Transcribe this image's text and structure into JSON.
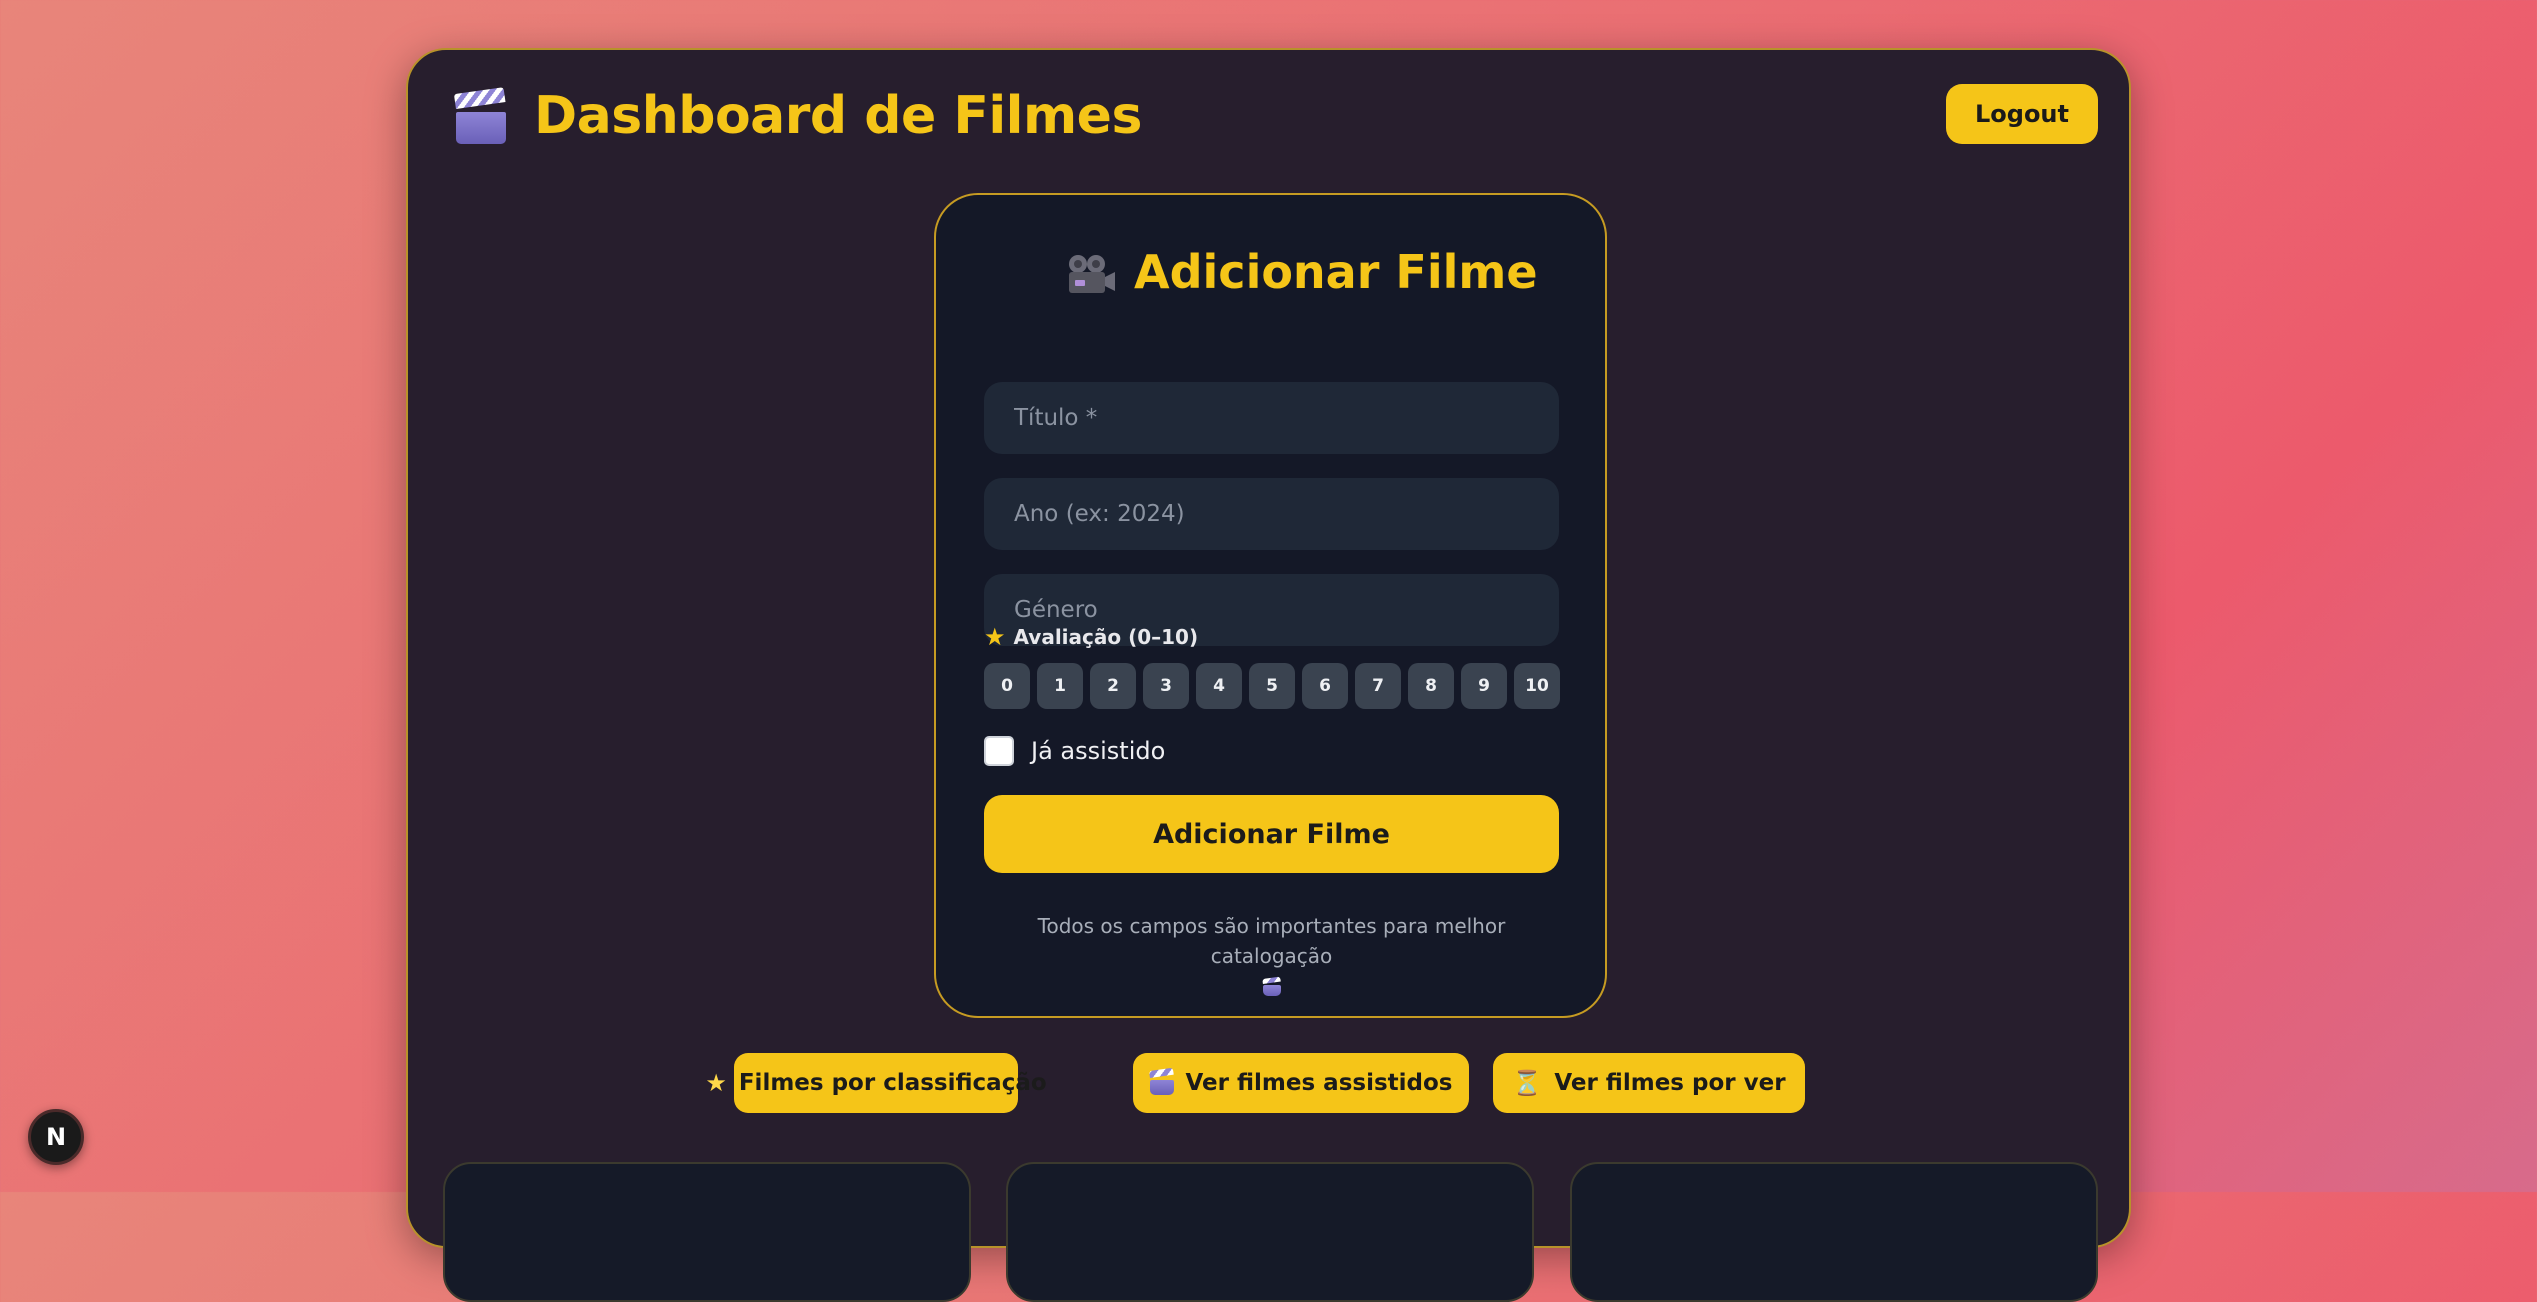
{
  "header": {
    "title": "Dashboard de Filmes",
    "logout_label": "Logout"
  },
  "form": {
    "title": "Adicionar Filme",
    "title_placeholder": "Título *",
    "year_placeholder": "Ano (ex: 2024)",
    "genre_placeholder": "Género",
    "rating_label": "Avaliação (0–10)",
    "rating_options": [
      "0",
      "1",
      "2",
      "3",
      "4",
      "5",
      "6",
      "7",
      "8",
      "9",
      "10"
    ],
    "watched_label": "Já assistido",
    "watched_checked": false,
    "submit_label": "Adicionar Filme",
    "hint": "Todos os campos são importantes para melhor catalogação"
  },
  "nav": {
    "by_rating_label": "Filmes por classificação",
    "watched_label": "Ver filmes assistidos",
    "to_watch_label": "Ver filmes por ver"
  },
  "dev_badge": {
    "label": "N"
  },
  "icons": {
    "header": "clapperboard-icon",
    "form_title": "movie-camera-icon",
    "rating": "star-icon",
    "hint": "clapperboard-icon",
    "nav_rating": "star-icon",
    "nav_watched": "clapperboard-icon",
    "nav_to_watch": "hourglass-icon"
  },
  "colors": {
    "accent": "#f5c518",
    "panel": "#271e2d",
    "card": "#141827",
    "input": "#1f2837",
    "rating_button": "#3a4350"
  }
}
